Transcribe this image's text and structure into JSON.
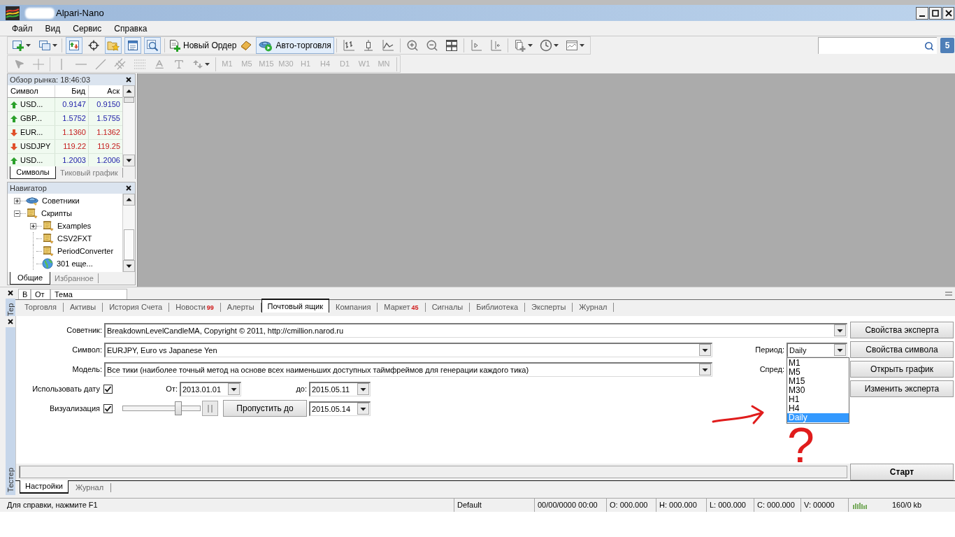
{
  "window": {
    "title": "Alpari-Nano"
  },
  "menu": [
    "Файл",
    "Вид",
    "Сервис",
    "Справка"
  ],
  "toolbar": {
    "view_toggles": [
      {
        "kind": "market-watch",
        "pressed": true
      },
      {
        "kind": "data-window",
        "pressed": false
      },
      {
        "kind": "navigator",
        "pressed": true
      },
      {
        "kind": "terminal",
        "pressed": true
      },
      {
        "kind": "tester",
        "pressed": true
      }
    ],
    "new_order": "Новый Ордер",
    "auto_trading": {
      "label": "Авто-торговля",
      "pressed": true
    },
    "messages": "5"
  },
  "drawing_toolbar": {
    "disabled": true,
    "timeframes": [
      "M1",
      "M5",
      "M15",
      "M30",
      "H1",
      "H4",
      "D1",
      "W1",
      "MN"
    ]
  },
  "market_watch": {
    "title": "Обзор рынка: 18:46:03",
    "columns": [
      "Символ",
      "Бид",
      "Аск"
    ],
    "rows": [
      {
        "symbol": "USD...",
        "bid": "0.9147",
        "ask": "0.9150",
        "kind": "up"
      },
      {
        "symbol": "GBP...",
        "bid": "1.5752",
        "ask": "1.5755",
        "kind": "up"
      },
      {
        "symbol": "EUR...",
        "bid": "1.1360",
        "ask": "1.1362",
        "kind": "down"
      },
      {
        "symbol": "USDJPY",
        "bid": "119.22",
        "ask": "119.25",
        "kind": "down"
      },
      {
        "symbol": "USD...",
        "bid": "1.2003",
        "ask": "1.2006",
        "kind": "up"
      }
    ],
    "tabs": [
      {
        "label": "Символы",
        "selected": true
      },
      {
        "label": "Тиковый график",
        "selected": false
      }
    ]
  },
  "navigator": {
    "title": "Навигатор",
    "tree": [
      {
        "label": "Советники",
        "kind": "experts",
        "expanded": false
      },
      {
        "label": "Скрипты",
        "kind": "scripts",
        "expanded": true,
        "children": [
          {
            "label": "Examples",
            "kind": "scripts",
            "expanded": false
          },
          {
            "label": "CSV2FXT",
            "kind": "scripts"
          },
          {
            "label": "PeriodConverter",
            "kind": "scripts"
          },
          {
            "label": "301 еще...",
            "kind": "more"
          }
        ]
      }
    ],
    "tabs": [
      {
        "label": "Общие",
        "selected": true
      },
      {
        "label": "Избранное",
        "selected": false
      }
    ]
  },
  "terminal": {
    "side_label": "Тер",
    "mail_columns": [
      "В",
      "От",
      "Тема"
    ],
    "tabs": [
      {
        "label": "Торговля",
        "selected": false
      },
      {
        "label": "Активы",
        "selected": false
      },
      {
        "label": "История Счета",
        "selected": false
      },
      {
        "label": "Новости",
        "badge": "99",
        "selected": false
      },
      {
        "label": "Алерты",
        "selected": false
      },
      {
        "label": "Почтовый ящик",
        "selected": true
      },
      {
        "label": "Компания",
        "selected": false
      },
      {
        "label": "Маркет",
        "badge": "45",
        "selected": false
      },
      {
        "label": "Сигналы",
        "selected": false
      },
      {
        "label": "Библиотека",
        "selected": false
      },
      {
        "label": "Эксперты",
        "selected": false
      },
      {
        "label": "Журнал",
        "selected": false
      }
    ]
  },
  "tester": {
    "side_label": "Тестер",
    "expert": {
      "label": "Советник:",
      "value": "BreakdownLevelCandleMA, Copyright © 2011, http://cmillion.narod.ru",
      "button": "Свойства эксперта"
    },
    "symbol": {
      "label": "Символ:",
      "value": "EURJPY, Euro vs Japanese Yen",
      "button": "Свойства символа"
    },
    "period": {
      "label": "Период:",
      "value": "Daily",
      "expanded": true,
      "options": [
        {
          "label": "M1",
          "selected": false
        },
        {
          "label": "M5",
          "selected": false
        },
        {
          "label": "M15",
          "selected": false
        },
        {
          "label": "M30",
          "selected": false
        },
        {
          "label": "H1",
          "selected": false
        },
        {
          "label": "H4",
          "selected": false
        },
        {
          "label": "Daily",
          "selected": true
        }
      ]
    },
    "model": {
      "label": "Модель:",
      "value": "Все тики (наиболее точный метод на основе всех наименьших доступных таймфреймов для генерации каждого тика)",
      "button": "Открыть график"
    },
    "spread": {
      "label": "Спред:"
    },
    "use_date": {
      "label": "Использовать дату",
      "checked": true,
      "from_label": "От:",
      "from": "2013.01.01",
      "to_label": "до:",
      "to": "2015.05.11",
      "button": "Изменить эксперта"
    },
    "visual": {
      "label": "Визуализация",
      "checked": true,
      "level": 0.72,
      "skip_button": "Пропустить до",
      "skip_date": "2015.05.14"
    },
    "progress": {
      "level": 0
    },
    "start_button": "Старт",
    "tabs": [
      {
        "label": "Настройки",
        "selected": true
      },
      {
        "label": "Журнал",
        "selected": false
      }
    ]
  },
  "status_bar": {
    "help": "Для справки, нажмите F1",
    "profile": "Default",
    "datetime": "00/00/0000 00:00",
    "open": "O: 000.000",
    "high": "H: 000.000",
    "low": "L: 000.000",
    "close": "C: 000.000",
    "volume": "V: 00000",
    "traffic": "160/0 kb"
  },
  "annotation": "?"
}
